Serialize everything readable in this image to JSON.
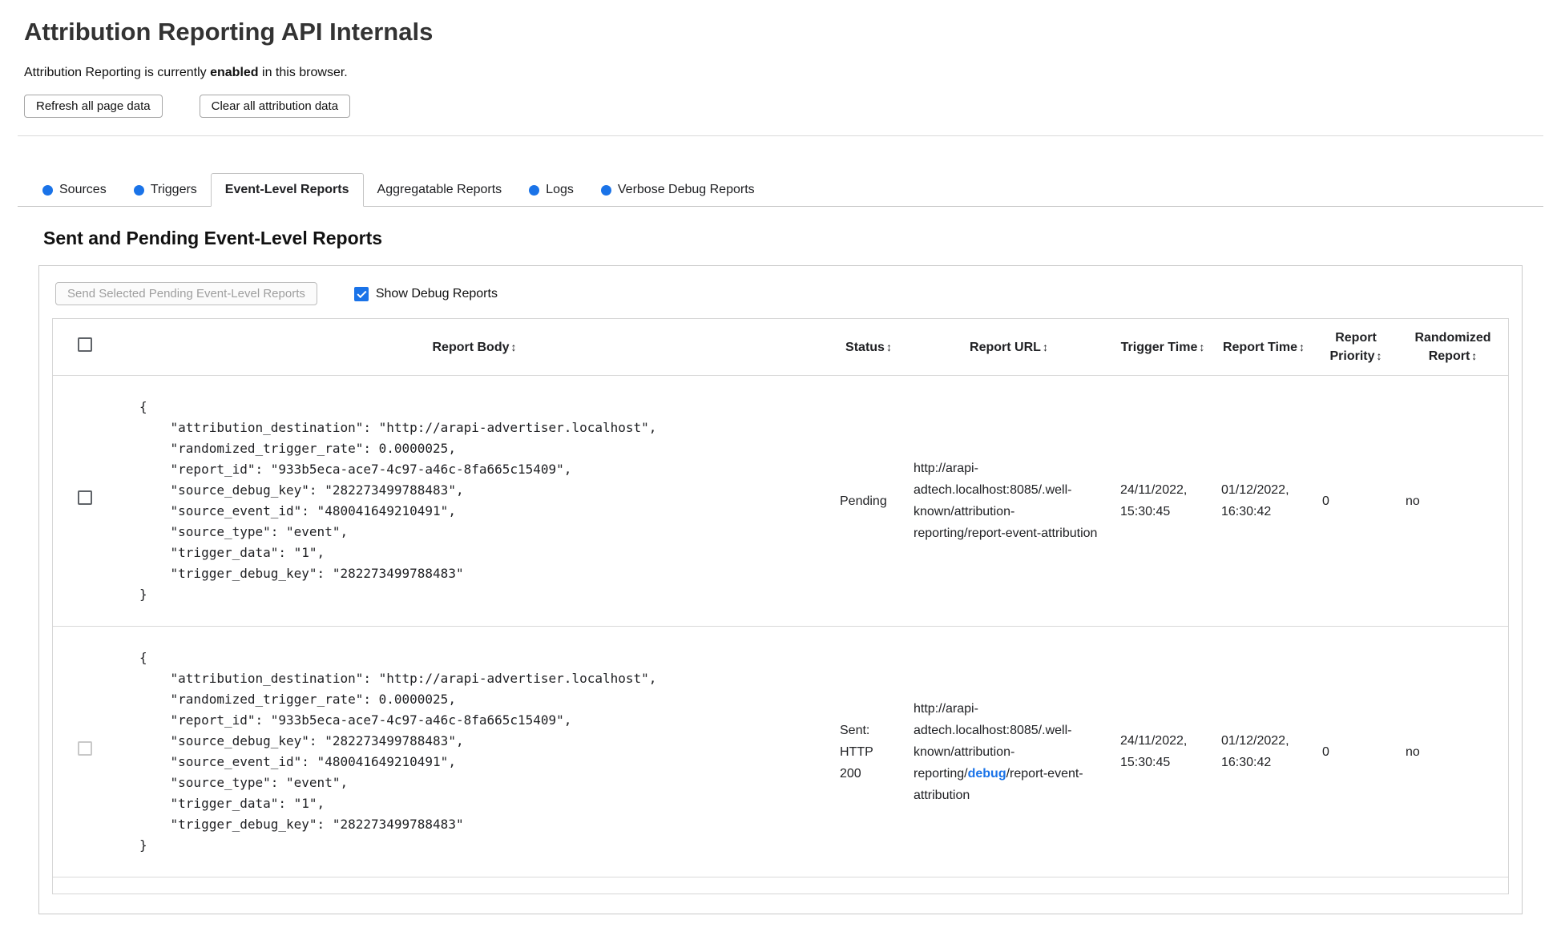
{
  "header": {
    "title": "Attribution Reporting API Internals",
    "status_prefix": "Attribution Reporting is currently ",
    "status_bold": "enabled",
    "status_suffix": " in this browser.",
    "refresh_button": "Refresh all page data",
    "clear_button": "Clear all attribution data"
  },
  "tabs": [
    {
      "label": "Sources",
      "dot": true,
      "selected": false
    },
    {
      "label": "Triggers",
      "dot": true,
      "selected": false
    },
    {
      "label": "Event-Level Reports",
      "dot": false,
      "selected": true
    },
    {
      "label": "Aggregatable Reports",
      "dot": false,
      "selected": false
    },
    {
      "label": "Logs",
      "dot": true,
      "selected": false
    },
    {
      "label": "Verbose Debug Reports",
      "dot": true,
      "selected": false
    }
  ],
  "section": {
    "heading": "Sent and Pending Event-Level Reports",
    "send_button": "Send Selected Pending Event-Level Reports",
    "send_button_disabled": true,
    "show_debug_label": "Show Debug Reports",
    "show_debug_checked": true
  },
  "table": {
    "sort_icon": "↕",
    "headers": {
      "report_body": "Report Body",
      "status": "Status",
      "report_url": "Report URL",
      "trigger_time": "Trigger Time",
      "report_time": "Report Time",
      "report_priority": "Report Priority",
      "randomized_report": "Randomized Report"
    },
    "rows": [
      {
        "selected": false,
        "checkbox_disabled": false,
        "report_body": "{\n    \"attribution_destination\": \"http://arapi-advertiser.localhost\",\n    \"randomized_trigger_rate\": 0.0000025,\n    \"report_id\": \"933b5eca-ace7-4c97-a46c-8fa665c15409\",\n    \"source_debug_key\": \"282273499788483\",\n    \"source_event_id\": \"480041649210491\",\n    \"source_type\": \"event\",\n    \"trigger_data\": \"1\",\n    \"trigger_debug_key\": \"282273499788483\"\n}",
        "status": "Pending",
        "url_prefix": "http://arapi-adtech.localhost:8085/.well-known/attribution-reporting/",
        "url_debug": "",
        "url_suffix": "report-event-attribution",
        "trigger_time": "24/11/2022, 15:30:45",
        "report_time": "01/12/2022, 16:30:42",
        "report_priority": "0",
        "randomized_report": "no"
      },
      {
        "selected": false,
        "checkbox_disabled": true,
        "report_body": "{\n    \"attribution_destination\": \"http://arapi-advertiser.localhost\",\n    \"randomized_trigger_rate\": 0.0000025,\n    \"report_id\": \"933b5eca-ace7-4c97-a46c-8fa665c15409\",\n    \"source_debug_key\": \"282273499788483\",\n    \"source_event_id\": \"480041649210491\",\n    \"source_type\": \"event\",\n    \"trigger_data\": \"1\",\n    \"trigger_debug_key\": \"282273499788483\"\n}",
        "status": "Sent: HTTP 200",
        "url_prefix": "http://arapi-adtech.localhost:8085/.well-known/attribution-reporting/",
        "url_debug": "debug",
        "url_suffix": "/report-event-attribution",
        "trigger_time": "24/11/2022, 15:30:45",
        "report_time": "01/12/2022, 16:30:42",
        "report_priority": "0",
        "randomized_report": "no"
      }
    ]
  },
  "colors": {
    "accent_blue": "#1a73e8",
    "dot_blue": "#1a73e8",
    "debug_link_blue": "#1a73e8"
  }
}
